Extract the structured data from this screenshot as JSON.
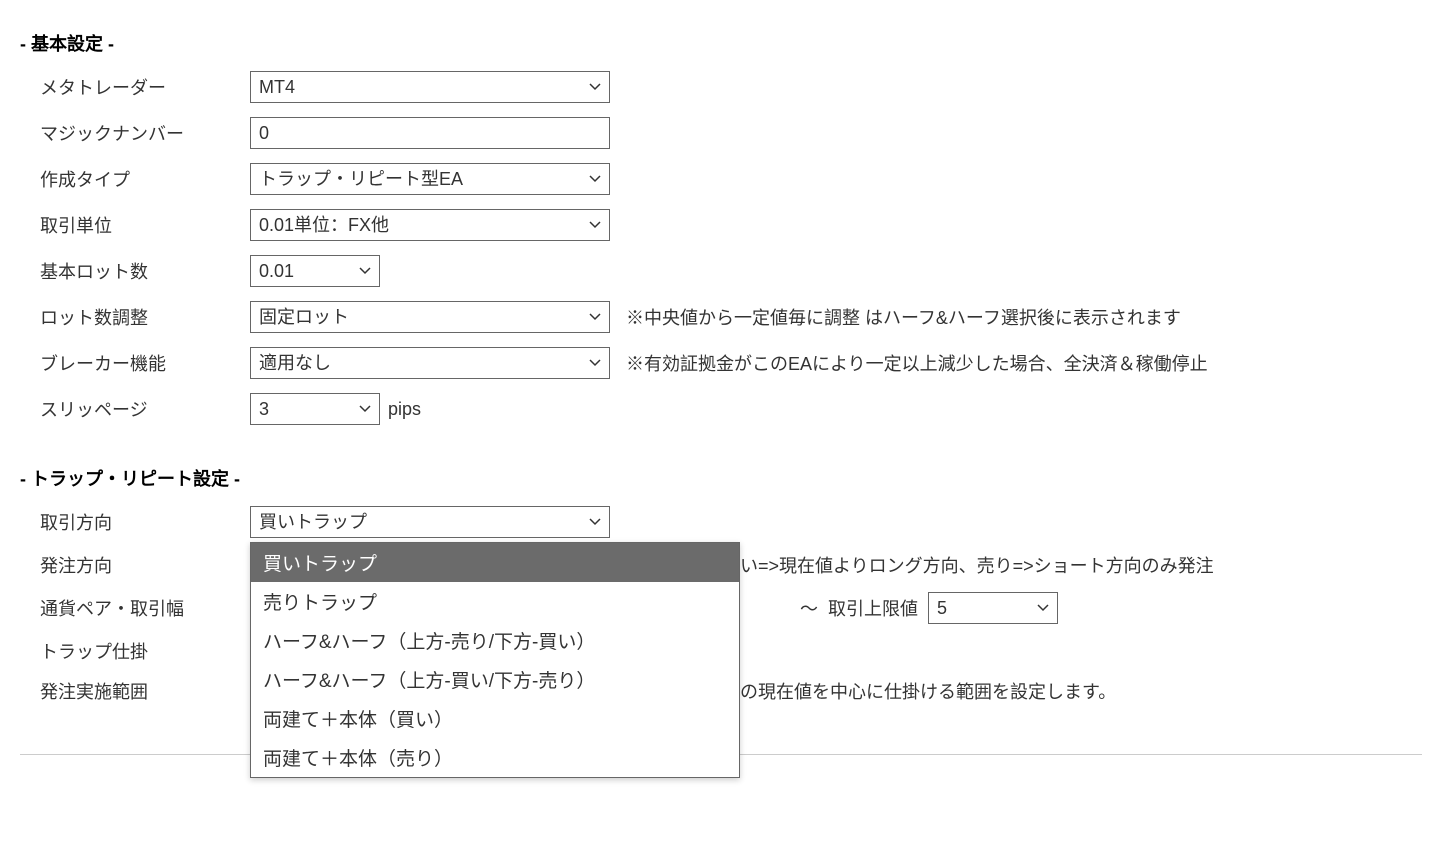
{
  "basic": {
    "header": "- 基本設定 -",
    "metatrader": {
      "label": "メタトレーダー",
      "value": "MT4"
    },
    "magic_number": {
      "label": "マジックナンバー",
      "value": "0"
    },
    "creation_type": {
      "label": "作成タイプ",
      "value": "トラップ・リピート型EA"
    },
    "unit": {
      "label": "取引単位",
      "value": "0.01単位：FX他"
    },
    "base_lot": {
      "label": "基本ロット数",
      "value": "0.01"
    },
    "lot_adjust": {
      "label": "ロット数調整",
      "value": "固定ロット",
      "note": "※中央値から一定値毎に調整 はハーフ&ハーフ選択後に表示されます"
    },
    "breaker": {
      "label": "ブレーカー機能",
      "value": "適用なし",
      "note": "※有効証拠金がこのEAにより一定以上減少した場合、全決済＆稼働停止"
    },
    "slippage": {
      "label": "スリッページ",
      "value": "3",
      "suffix": "pips"
    }
  },
  "trap": {
    "header": "- トラップ・リピート設定 -",
    "direction": {
      "label": "取引方向",
      "value": "買いトラップ",
      "options": [
        "買いトラップ",
        "売りトラップ",
        "ハーフ&ハーフ（上方-売り/下方-買い）",
        "ハーフ&ハーフ（上方-買い/下方-売り）",
        "両建て＋本体（買い）",
        "両建て＋本体（売り）"
      ],
      "selected_index": 0
    },
    "order_direction": {
      "label": "発注方向",
      "note_tail": "い=>現在値よりロング方向、売り=>ショート方向のみ発注"
    },
    "pair_range": {
      "label": "通貨ペア・取引幅",
      "tilde": "～",
      "upper_label": "取引上限値",
      "upper_value": "5"
    },
    "trap_set": {
      "label": "トラップ仕掛"
    },
    "order_range": {
      "label": "発注実施範囲",
      "note_tail": "の現在値を中心に仕掛ける範囲を設定します。"
    }
  }
}
